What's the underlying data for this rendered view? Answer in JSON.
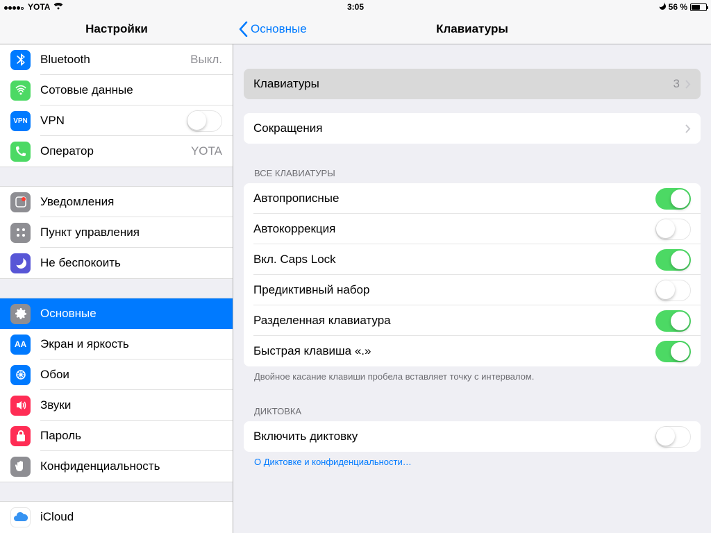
{
  "statusbar": {
    "carrier": "YOTA",
    "time": "3:05",
    "battery": "56 %"
  },
  "sidebar_title": "Настройки",
  "nav_back": "Основные",
  "detail_title": "Клавиатуры",
  "side": {
    "bluetooth": "Bluetooth",
    "bluetooth_val": "Выкл.",
    "cellular": "Сотовые данные",
    "vpn": "VPN",
    "carrier": "Оператор",
    "carrier_val": "YOTA",
    "notifications": "Уведомления",
    "control_center": "Пункт управления",
    "dnd": "Не беспокоить",
    "general": "Основные",
    "display": "Экран и яркость",
    "wallpaper": "Обои",
    "sounds": "Звуки",
    "passcode": "Пароль",
    "privacy": "Конфиденциальность",
    "icloud": "iCloud"
  },
  "keyboards_row": {
    "label": "Клавиатуры",
    "count": "3"
  },
  "shortcuts_row": {
    "label": "Сокращения"
  },
  "all_kb_header": "ВСЕ КЛАВИАТУРЫ",
  "switches": {
    "autocap": {
      "label": "Автопрописные",
      "on": true
    },
    "autocorrect": {
      "label": "Автокоррекция",
      "on": false
    },
    "capslock": {
      "label": "Вкл. Caps Lock",
      "on": true
    },
    "predictive": {
      "label": "Предиктивный набор",
      "on": false
    },
    "split": {
      "label": "Разделенная клавиатура",
      "on": true
    },
    "period": {
      "label": "Быстрая клавиша «.»",
      "on": true
    }
  },
  "period_footer": "Двойное касание клавиши пробела вставляет точку с интервалом.",
  "dictation_header": "ДИКТОВКА",
  "dictation": {
    "label": "Включить диктовку",
    "on": false
  },
  "dictation_link": "О Диктовке и конфиденциальности…"
}
